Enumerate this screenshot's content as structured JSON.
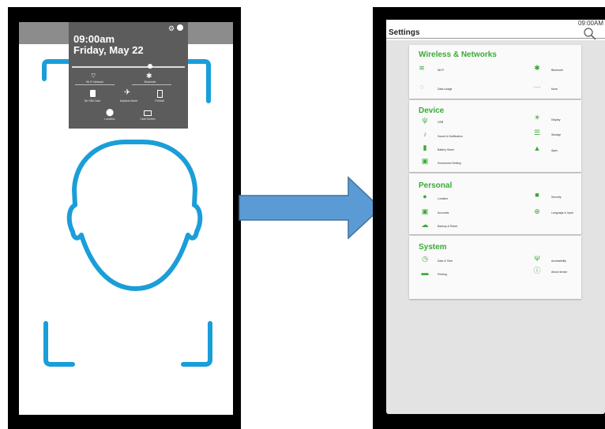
{
  "lock_screen": {
    "time": "09:00am",
    "date": "Friday, May 22",
    "toggles": [
      "Wi-Fi Network",
      "Bluetooth",
      "No SIM Card",
      "Airplane Mode",
      "Portrait",
      "Location",
      "Cast Screen"
    ]
  },
  "settings_screen": {
    "status_time": "09:00AM",
    "title": "Settings",
    "sections": [
      {
        "title": "Wireless & Networks",
        "items": [
          "Wi-Fi",
          "Bluetooth",
          "Data Usage",
          "More"
        ]
      },
      {
        "title": "Device",
        "items": [
          "USB",
          "Display",
          "Sound & Notification",
          "Storage",
          "Battery Saver",
          "Apps",
          "Screenshot Setting"
        ]
      },
      {
        "title": "Personal",
        "items": [
          "Location",
          "Security",
          "Accounts",
          "Language & Input",
          "Backup & Reset"
        ]
      },
      {
        "title": "System",
        "items": [
          "Date & Time",
          "Accessibility",
          "Printing",
          "About device"
        ]
      }
    ]
  },
  "colors": {
    "face_outline": "#1a9ed9",
    "arrow_fill": "#5b9bd5",
    "arrow_stroke": "#41719c",
    "accent_green": "#3aaa35"
  }
}
